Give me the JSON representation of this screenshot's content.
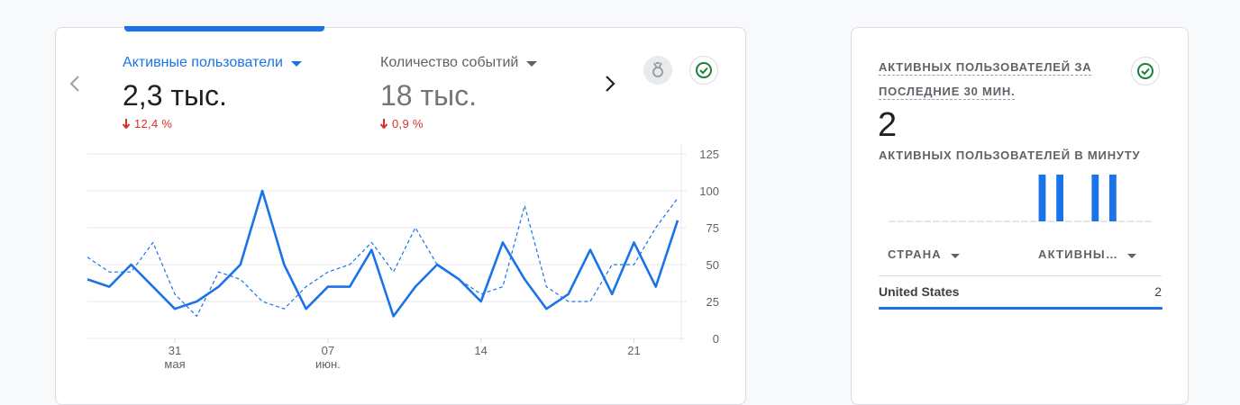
{
  "main_card": {
    "metrics": [
      {
        "label": "Активные пользователи",
        "value": "2,3 тыс.",
        "change": "12,4 %",
        "selected": true
      },
      {
        "label": "Количество событий",
        "value": "18 тыс.",
        "change": "0,9 %",
        "selected": false
      }
    ],
    "icons": {
      "prev": "chevron-left-icon",
      "next": "chevron-right-icon",
      "insight": "insights-icon",
      "check": "check-circle-icon"
    }
  },
  "chart_data": {
    "type": "line",
    "x_tick_labels": [
      {
        "top": "31",
        "bottom": "мая"
      },
      {
        "top": "07",
        "bottom": "июн."
      },
      {
        "top": "14",
        "bottom": ""
      },
      {
        "top": "21",
        "bottom": ""
      }
    ],
    "x": [
      "27 мая",
      "28 мая",
      "29 мая",
      "30 мая",
      "31 мая",
      "1 июн.",
      "2 июн.",
      "3 июн.",
      "4 июн.",
      "5 июн.",
      "6 июн.",
      "7 июн.",
      "8 июн.",
      "9 июн.",
      "10 июн.",
      "11 июн.",
      "12 июн.",
      "13 июн.",
      "14 июн.",
      "15 июн.",
      "16 июн.",
      "17 июн.",
      "18 июн.",
      "19 июн.",
      "20 июн.",
      "21 июн.",
      "22 июн."
    ],
    "y_ticks": [
      0,
      25,
      50,
      75,
      100,
      125
    ],
    "ylim": [
      0,
      125
    ],
    "grid": true,
    "series": [
      {
        "style": "solid",
        "color": "#1a73e8",
        "values": [
          40,
          35,
          50,
          35,
          20,
          25,
          35,
          50,
          100,
          50,
          20,
          35,
          35,
          60,
          15,
          35,
          50,
          40,
          25,
          65,
          40,
          20,
          30,
          60,
          30,
          65,
          35,
          80
        ]
      },
      {
        "style": "dashed",
        "color": "#1a73e8",
        "values": [
          55,
          45,
          45,
          65,
          30,
          15,
          45,
          40,
          25,
          20,
          35,
          45,
          50,
          65,
          45,
          75,
          50,
          40,
          30,
          35,
          90,
          35,
          25,
          25,
          50,
          50,
          75,
          95
        ]
      }
    ]
  },
  "realtime_card": {
    "title_line1": "АКТИВНЫХ ПОЛЬЗОВАТЕЛЕЙ ЗА",
    "title_line2": "ПОСЛЕДНИЕ 30 МИН.",
    "value": "2",
    "subtitle": "АКТИВНЫХ ПОЛЬЗОВАТЕЛЕЙ В МИНУТУ",
    "per_minute": [
      0,
      0,
      0,
      0,
      0,
      0,
      0,
      0,
      0,
      0,
      0,
      0,
      0,
      0,
      0,
      0,
      0,
      1,
      0,
      1,
      0,
      0,
      0,
      1,
      0,
      1,
      0,
      0,
      0,
      0
    ],
    "table": {
      "col_country": "СТРАНА",
      "col_active": "АКТИВНЫ…",
      "rows": [
        {
          "country": "United States",
          "count": "2"
        }
      ]
    },
    "accent": "#1a73e8"
  }
}
